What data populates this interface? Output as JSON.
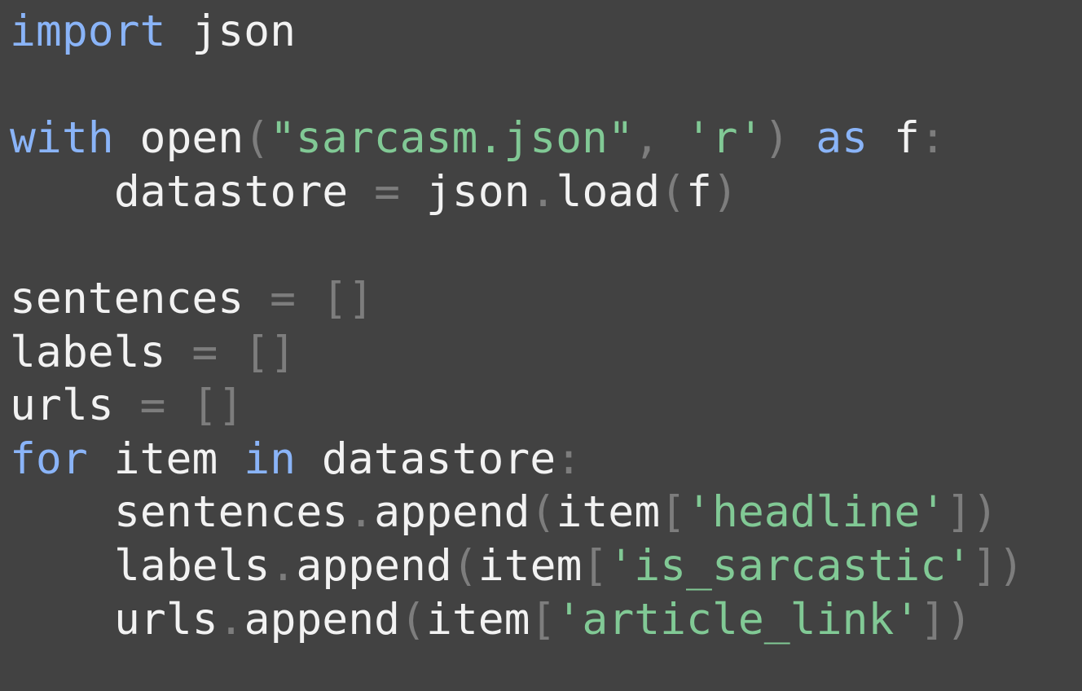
{
  "editor": {
    "language": "python",
    "colors": {
      "background": "#424242",
      "text": "#f2f2f2",
      "keyword": "#8ab4f8",
      "string": "#81c995",
      "punctuation": "#7d7d7d"
    },
    "lines": [
      [
        {
          "t": "kw",
          "v": "import"
        },
        {
          "t": "txt",
          "v": " json"
        }
      ],
      [],
      [
        {
          "t": "kw",
          "v": "with"
        },
        {
          "t": "txt",
          "v": " open"
        },
        {
          "t": "pun",
          "v": "("
        },
        {
          "t": "str",
          "v": "\"sarcasm.json\""
        },
        {
          "t": "pun",
          "v": ", "
        },
        {
          "t": "str",
          "v": "'r'"
        },
        {
          "t": "pun",
          "v": ")"
        },
        {
          "t": "txt",
          "v": " "
        },
        {
          "t": "kw",
          "v": "as"
        },
        {
          "t": "txt",
          "v": " f"
        },
        {
          "t": "pun",
          "v": ":"
        }
      ],
      [
        {
          "t": "indent",
          "v": ""
        },
        {
          "t": "txt",
          "v": "datastore"
        },
        {
          "t": "pun",
          "v": " = "
        },
        {
          "t": "txt",
          "v": "json"
        },
        {
          "t": "pun",
          "v": "."
        },
        {
          "t": "txt",
          "v": "load"
        },
        {
          "t": "pun",
          "v": "("
        },
        {
          "t": "txt",
          "v": "f"
        },
        {
          "t": "pun",
          "v": ")"
        }
      ],
      [],
      [
        {
          "t": "txt",
          "v": "sentences"
        },
        {
          "t": "pun",
          "v": " = []"
        }
      ],
      [
        {
          "t": "txt",
          "v": "labels"
        },
        {
          "t": "pun",
          "v": " = []"
        }
      ],
      [
        {
          "t": "txt",
          "v": "urls"
        },
        {
          "t": "pun",
          "v": " = []"
        }
      ],
      [
        {
          "t": "kw",
          "v": "for"
        },
        {
          "t": "txt",
          "v": " item "
        },
        {
          "t": "kw",
          "v": "in"
        },
        {
          "t": "txt",
          "v": " datastore"
        },
        {
          "t": "pun",
          "v": ":"
        }
      ],
      [
        {
          "t": "indent",
          "v": ""
        },
        {
          "t": "txt",
          "v": "sentences"
        },
        {
          "t": "pun",
          "v": "."
        },
        {
          "t": "txt",
          "v": "append"
        },
        {
          "t": "pun",
          "v": "("
        },
        {
          "t": "txt",
          "v": "item"
        },
        {
          "t": "pun",
          "v": "["
        },
        {
          "t": "str",
          "v": "'headline'"
        },
        {
          "t": "pun",
          "v": "])"
        }
      ],
      [
        {
          "t": "indent",
          "v": ""
        },
        {
          "t": "txt",
          "v": "labels"
        },
        {
          "t": "pun",
          "v": "."
        },
        {
          "t": "txt",
          "v": "append"
        },
        {
          "t": "pun",
          "v": "("
        },
        {
          "t": "txt",
          "v": "item"
        },
        {
          "t": "pun",
          "v": "["
        },
        {
          "t": "str",
          "v": "'is_sarcastic'"
        },
        {
          "t": "pun",
          "v": "])"
        }
      ],
      [
        {
          "t": "indent",
          "v": ""
        },
        {
          "t": "txt",
          "v": "urls"
        },
        {
          "t": "pun",
          "v": "."
        },
        {
          "t": "txt",
          "v": "append"
        },
        {
          "t": "pun",
          "v": "("
        },
        {
          "t": "txt",
          "v": "item"
        },
        {
          "t": "pun",
          "v": "["
        },
        {
          "t": "str",
          "v": "'article_link'"
        },
        {
          "t": "pun",
          "v": "])"
        }
      ]
    ]
  }
}
